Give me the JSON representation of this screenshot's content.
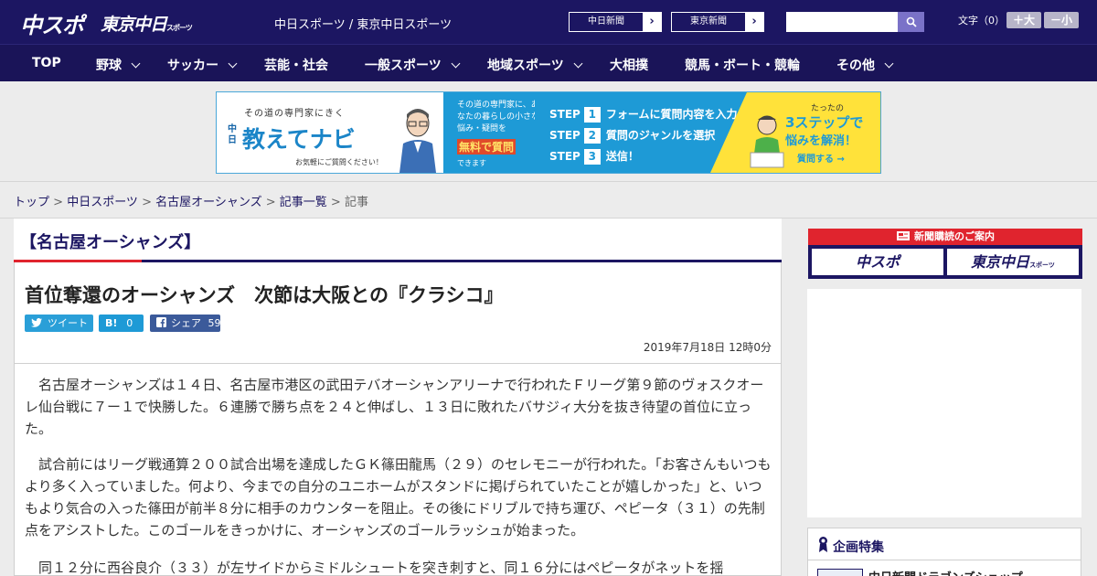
{
  "header": {
    "logo_chuspo": "中スポ",
    "logo_tokyo": "東京中日",
    "logo_tokyo_sub": "スポーツ",
    "site_links": "中日スポーツ / 東京中日スポーツ",
    "paper_buttons": [
      {
        "label": "中日新聞"
      },
      {
        "label": "東京新聞"
      }
    ],
    "search_placeholder": "",
    "fontsize_label": "文字（0）",
    "font_up": "＋大",
    "font_down": "－小"
  },
  "nav": {
    "items": [
      {
        "label": "TOP",
        "has_menu": false
      },
      {
        "label": "野球",
        "has_menu": true
      },
      {
        "label": "サッカー",
        "has_menu": true
      },
      {
        "label": "芸能・社会",
        "has_menu": false
      },
      {
        "label": "一般スポーツ",
        "has_menu": true
      },
      {
        "label": "地域スポーツ",
        "has_menu": true
      },
      {
        "label": "大相撲",
        "has_menu": false
      },
      {
        "label": "競馬・ボート・競輪",
        "has_menu": false
      },
      {
        "label": "その他",
        "has_menu": true
      }
    ]
  },
  "ad": {
    "tagline": "その道の専門家にきく",
    "brand_small": "中日",
    "title": "教えてナビ",
    "note": "お気軽にご質問ください！",
    "mid_text": "その道の専門家に、あなたの暮らしの小さな悩み・疑問を",
    "mid_highlight": "無料で質問",
    "mid_sub": "できます",
    "steps": [
      {
        "word": "STEP",
        "num": "1",
        "text": "フォームに質問内容を入力"
      },
      {
        "word": "STEP",
        "num": "2",
        "text": "質問のジャンルを選択"
      },
      {
        "word": "STEP",
        "num": "3",
        "text": "送信！"
      }
    ],
    "right_small": "たったの",
    "right_big": "3ステップで",
    "right_big2": "悩みを解消！",
    "right_cta": "質問する →"
  },
  "breadcrumb": {
    "items": [
      "トップ",
      "中日スポーツ",
      "名古屋オーシャンズ",
      "記事一覧"
    ],
    "current": "記事",
    "separator": " > "
  },
  "article": {
    "category": "【名古屋オーシャンズ】",
    "headline": "首位奪還のオーシャンズ　次節は大阪との『クラシコ』",
    "share": {
      "tweet": "ツイート",
      "hatena_label": "B!",
      "hatena_count": "0",
      "facebook_label": "シェア",
      "facebook_count": "59"
    },
    "date": "2019年7月18日 12時0分",
    "paragraphs": [
      "名古屋オーシャンズは１４日、名古屋市港区の武田テバオーシャンアリーナで行われたＦリーグ第９節のヴォスクオーレ仙台戦に７ー１で快勝した。６連勝で勝ち点を２４と伸ばし、１３日に敗れたバサジィ大分を抜き待望の首位に立った。",
      "試合前にはリーグ戦通算２００試合出場を達成したＧＫ篠田龍馬（２９）のセレモニーが行われた。「お客さんもいつもより多く入っていました。何より、今までの自分のユニホームがスタンドに掲げられていたことが嬉しかった」と、いつもより気合の入った篠田が前半８分に相手のカウンターを阻止。その後にドリブルで持ち運び、ペピータ（３１）の先制点をアシストした。このゴールをきっかけに、オーシャンズのゴールラッシュが始まった。",
      "同１２分に西谷良介（３３）が左サイドからミドルシュートを突き刺すと、同１６分にはペピータがネットを揺"
    ]
  },
  "sidebar": {
    "subscribe_head": "新聞購読のご案内",
    "subscribe_logos": [
      "中スポ",
      "東京中日"
    ],
    "subscribe_logo_sub": "スポーツ",
    "feature_title": "企画特集",
    "feature_link": "中日新聞ドラゴンズショップ"
  },
  "colors": {
    "brand_navy": "#1c1662",
    "accent_red": "#e0242e",
    "ad_blue": "#1e9ad6",
    "ad_yellow": "#ffe23a"
  }
}
